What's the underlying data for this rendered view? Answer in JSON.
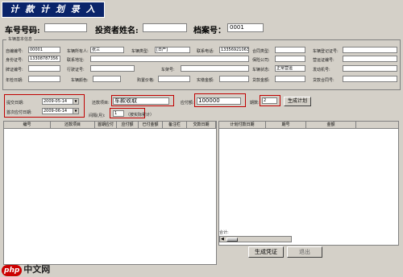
{
  "window": {
    "title": "计 款 计 划 录 入"
  },
  "top": {
    "plate_label": "车号号码:",
    "plate_value": "",
    "investor_label": "投资者姓名:",
    "investor_value": "",
    "file_label": "档案号：",
    "file_value": "0001"
  },
  "info": {
    "group_title": "车辆基本信息",
    "rows": [
      [
        {
          "label": "自编编号:",
          "value": "00001"
        },
        {
          "label": "车辆所有人:",
          "value": "张三"
        },
        {
          "label": "车辆类型:",
          "value": "[日产]"
        },
        {
          "label": "联系电话:",
          "value": "13356921063"
        },
        {
          "label": "合同类型:",
          "value": ""
        },
        {
          "label": "车辆登记证号:",
          "value": ""
        }
      ],
      [
        {
          "label": "身份证号:",
          "value": "13308787356"
        },
        {
          "label": "联系地址:",
          "value": ""
        },
        {
          "label": "",
          "value": ""
        },
        {
          "label": "",
          "value": ""
        },
        {
          "label": "保险公司:",
          "value": ""
        },
        {
          "label": "营运证编号:",
          "value": ""
        }
      ],
      [
        {
          "label": "牌证编号:",
          "value": ""
        },
        {
          "label": "行驶证号:",
          "value": ""
        },
        {
          "label": "车架号:",
          "value": ""
        },
        {
          "label": "",
          "value": ""
        },
        {
          "label": "车辆状态:",
          "value": "正常营运"
        },
        {
          "label": "发动机号:",
          "value": ""
        }
      ],
      [
        {
          "label": "年检日期:",
          "value": ""
        },
        {
          "label": "车辆颜色:",
          "value": ""
        },
        {
          "label": "购置价格:",
          "value": ""
        },
        {
          "label": "实缴金额:",
          "value": ""
        },
        {
          "label": "贷款金额:",
          "value": ""
        },
        {
          "label": "贷款合同号:",
          "value": ""
        }
      ]
    ]
  },
  "plan": {
    "start_date_label": "提交日期:",
    "start_date_value": "2009-05-14",
    "first_pay_label": "首次应付日期:",
    "first_pay_value": "2009-06-14",
    "item_label": "还款项目:",
    "item_value": "车款收取",
    "months_label": "间隔(月):",
    "months_value": "1",
    "months_note": "（按实际累计）",
    "amount_label": "应付额:",
    "amount_value": "100000",
    "periods_label": "期数:",
    "periods_value": "2",
    "gen_btn": "生成计划"
  },
  "left_table": {
    "headers": [
      "编号",
      "还款项目",
      "首期应付",
      "应付额",
      "已付金额",
      "备注栏",
      "交款日期"
    ]
  },
  "right_table": {
    "headers": [
      "计划付款日期",
      "期号",
      "金额"
    ],
    "total_label": "合计:"
  },
  "buttons": {
    "generate_doc": "生成凭证",
    "exit": "退出"
  },
  "watermark": {
    "logo": "php",
    "site": "中文网"
  }
}
